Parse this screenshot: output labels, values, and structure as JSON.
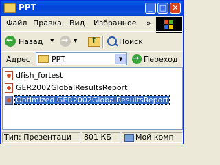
{
  "window": {
    "title": "PPT",
    "controls": {
      "minimize": "_",
      "maximize": "□",
      "close": "✕"
    }
  },
  "menu": {
    "items": [
      "Файл",
      "Правка",
      "Вид",
      "Избранное"
    ],
    "more": "»"
  },
  "toolbar": {
    "back_label": "Назад",
    "search_label": "Поиск"
  },
  "address": {
    "label": "Адрес",
    "value": "PPT",
    "go_label": "Переход"
  },
  "files": [
    {
      "name": "dfish_fortest",
      "selected": false
    },
    {
      "name": "GER2002GlobalResultsReport",
      "selected": false
    },
    {
      "name": "Optimized GER2002GlobalResultsReport",
      "selected": true
    }
  ],
  "status": {
    "type": "Тип: Презентаци",
    "size": "801 КБ",
    "location": "Мой комп"
  },
  "colors": {
    "titlebar": "#0a4fd8",
    "selection": "#316ac5",
    "window_bg": "#ece9d8"
  }
}
